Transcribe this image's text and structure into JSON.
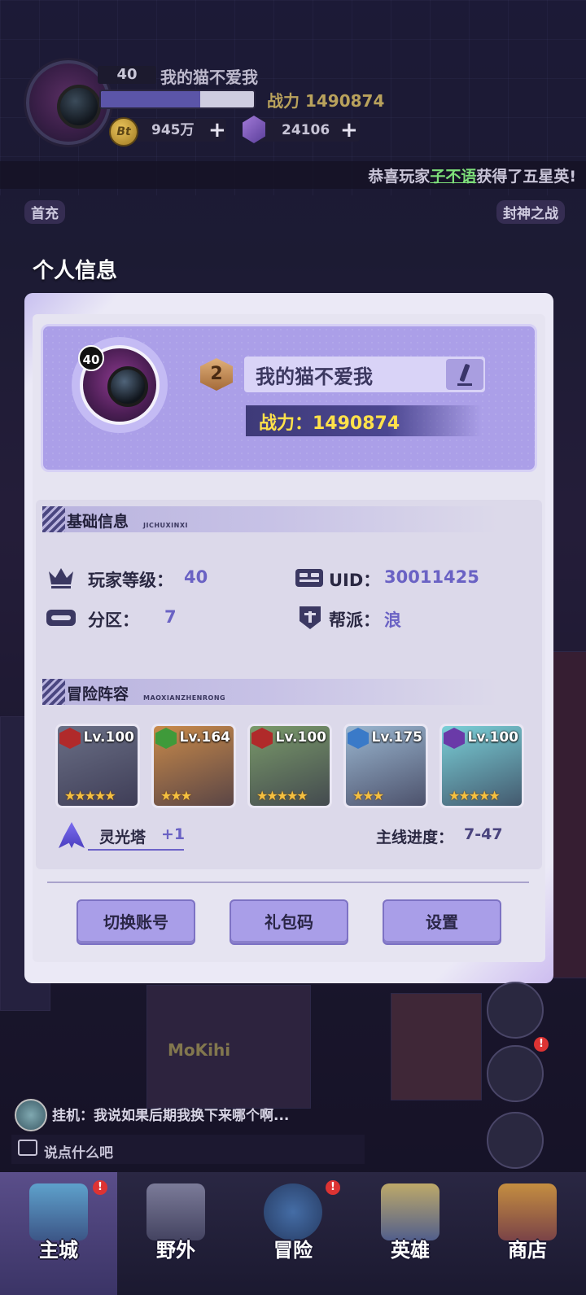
{
  "hud": {
    "level": "40",
    "player_name": "我的猫不爱我",
    "xp_fraction": 0.65,
    "power": "战力 1490874",
    "coin_symbol": "Bt",
    "coins": "945万",
    "gems": "24106"
  },
  "marquee": {
    "prefix": "恭喜玩家",
    "player": "子不语",
    "suffix": "获得了五星英!"
  },
  "side_labels": {
    "left_top": "首充",
    "right_top": "封神之战"
  },
  "panel": {
    "title": "个人信息",
    "profile": {
      "level_badge": "40",
      "rank": "2",
      "name": "我的猫不爱我",
      "power": "战力：1490874"
    },
    "basic": {
      "title": "基础信息",
      "subtitle": "JICHUXINXI",
      "player_level_label": "玩家等级：",
      "player_level_value": "40",
      "uid_label": "UID：",
      "uid_value": "30011425",
      "zone_label": "分区：",
      "zone_value": "7",
      "guild_label": "帮派：",
      "guild_value": "浪"
    },
    "lineup": {
      "title": "冒险阵容",
      "subtitle": "MAOXIANZHENRONG",
      "heroes": [
        {
          "level": "Lv.100",
          "stars": "★★★★★",
          "class_color": "#b02a2a",
          "bg": "#6a6f86"
        },
        {
          "level": "Lv.164",
          "stars": "★★★",
          "class_color": "#3f9a3a",
          "bg": "#c98a4a"
        },
        {
          "level": "Lv.100",
          "stars": "★★★★★",
          "class_color": "#b02a2a",
          "bg": "#7a9a6a"
        },
        {
          "level": "Lv.175",
          "stars": "★★★",
          "class_color": "#3a7ac8",
          "bg": "#9ab6d0"
        },
        {
          "level": "Lv.100",
          "stars": "★★★★★",
          "class_color": "#6a3aa8",
          "bg": "#7ad0d8"
        }
      ],
      "tower_label": "灵光塔",
      "tower_value": "+1",
      "progress_label": "主线进度：",
      "progress_value": "7-47"
    },
    "buttons": {
      "switch_account": "切换账号",
      "gift_code": "礼包码",
      "settings": "设置"
    }
  },
  "chat": {
    "last_message": "挂机：我说如果后期我换下来哪个啊...",
    "placeholder": "说点什么吧"
  },
  "nav": {
    "main_city": "主城",
    "wild": "野外",
    "adventure": "冒险",
    "heroes": "英雄",
    "shop": "商店",
    "badge": "!"
  },
  "scene_sign": "MoKihi"
}
